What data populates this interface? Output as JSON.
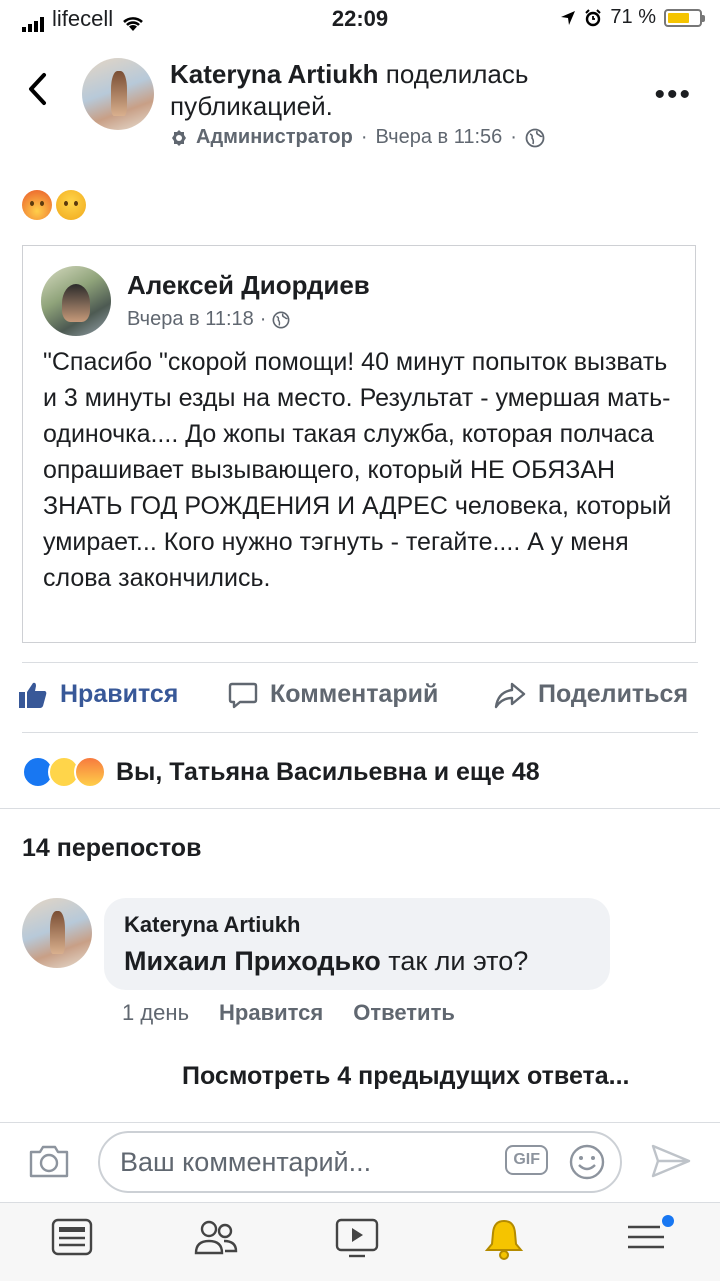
{
  "status_bar": {
    "carrier": "lifecell",
    "time": "22:09",
    "battery": "71 %",
    "battery_level": 0.71
  },
  "header": {
    "author": "Kateryna Artiukh",
    "action": "поделилась публикацией.",
    "role": "Администратор",
    "timestamp": "Вчера в 11:56",
    "reactions": [
      "angry-face-emoji",
      "crying-face-emoji"
    ]
  },
  "shared_post": {
    "author": "Алексей Диордиев",
    "timestamp": "Вчера в 11:18",
    "text": "\"Спасибо \"скорой помощи! 40 минут попыток вызвать и 3 минуты езды на место. Результат - умершая мать-одиночка.... До жопы такая служба, которая полчаса опрашивает вызывающего, который НЕ ОБЯЗАН ЗНАТЬ ГОД РОЖДЕНИЯ И АДРЕС человека, который умирает... Кого нужно тэгнуть - тегайте.... А у меня слова закончились."
  },
  "actions": {
    "like": "Нравится",
    "comment": "Комментарий",
    "share": "Поделиться"
  },
  "reactions_summary": "Вы, Татьяна Васильевна и еще 48",
  "shares_count": "14 перепостов",
  "comment": {
    "author": "Kateryna Artiukh",
    "mention": "Михаил Приходько",
    "text": " так ли это?",
    "age": "1 день",
    "like": "Нравится",
    "reply": "Ответить"
  },
  "view_replies": "Посмотреть 4 предыдущих ответа...",
  "composer": {
    "placeholder": "Ваш комментарий...",
    "gif": "GIF"
  },
  "colors": {
    "accent": "#385898",
    "notification": "#1877f2",
    "battery": "#f5c400"
  }
}
